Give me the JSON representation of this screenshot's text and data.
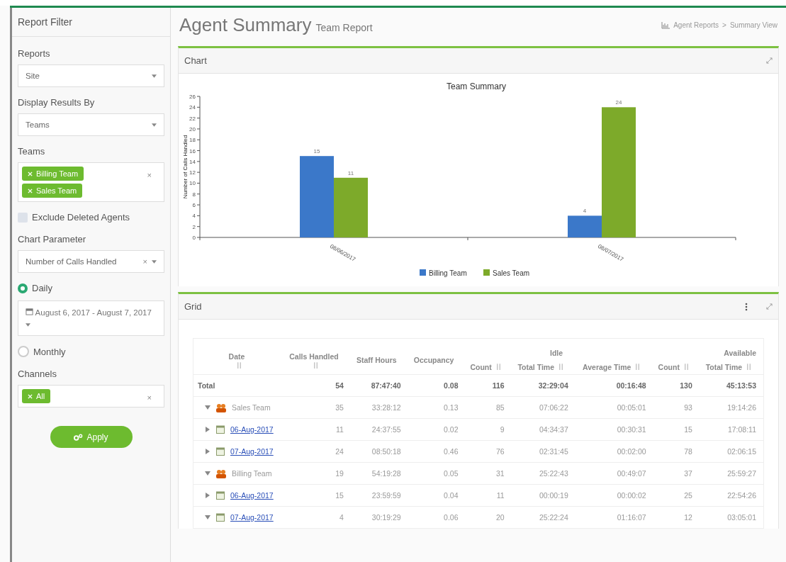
{
  "sidebar": {
    "title": "Report Filter",
    "reports": {
      "label": "Reports",
      "value": "Site"
    },
    "display_by": {
      "label": "Display Results By",
      "value": "Teams"
    },
    "teams": {
      "label": "Teams",
      "tags": [
        "Billing Team",
        "Sales Team"
      ],
      "clear": "×"
    },
    "exclude_deleted": {
      "label": "Exclude Deleted Agents",
      "checked": false
    },
    "chart_parameter": {
      "label": "Chart Parameter",
      "value": "Number of Calls Handled",
      "clear": "×"
    },
    "periods": [
      {
        "label": "Daily",
        "selected": true,
        "date_range": "August 6, 2017 - August 7, 2017"
      },
      {
        "label": "Monthly",
        "selected": false
      }
    ],
    "channels": {
      "label": "Channels",
      "tags": [
        "All"
      ],
      "clear": "×"
    },
    "apply": "Apply"
  },
  "header": {
    "title": "Agent Summary",
    "subtitle": "Team Report",
    "breadcrumb": [
      "Agent Reports",
      "Summary View"
    ],
    "separator": ">"
  },
  "chart_panel": {
    "title": "Chart",
    "chart_data": {
      "type": "bar",
      "title": "Team Summary",
      "ylabel": "Number of Calls Handled",
      "categories": [
        "08/06/2017",
        "08/07/2017"
      ],
      "series": [
        {
          "name": "Billing Team",
          "color": "#3b78c9",
          "values": [
            15,
            4
          ]
        },
        {
          "name": "Sales Team",
          "color": "#7daa2a",
          "values": [
            11,
            24
          ]
        }
      ],
      "ylim": [
        0,
        26
      ],
      "yticks": [
        0,
        2,
        4,
        6,
        8,
        10,
        12,
        14,
        16,
        18,
        20,
        22,
        24,
        26
      ],
      "data_labels": true,
      "legend": true
    }
  },
  "grid_panel": {
    "title": "Grid",
    "groups": [
      {
        "label": "Idle"
      },
      {
        "label": "Available"
      }
    ],
    "columns": [
      "Date",
      "Calls Handled",
      "Staff Hours",
      "Occupancy",
      "Count",
      "Total Time",
      "Average Time",
      "Count",
      "Total Time"
    ],
    "rows": [
      {
        "kind": "total",
        "cells": [
          "Total",
          "54",
          "87:47:40",
          "0.08",
          "116",
          "32:29:04",
          "00:16:48",
          "130",
          "45:13:53"
        ]
      },
      {
        "kind": "team",
        "expanded": true,
        "cells": [
          "Sales Team",
          "35",
          "33:28:12",
          "0.13",
          "85",
          "07:06:22",
          "00:05:01",
          "93",
          "19:14:26"
        ]
      },
      {
        "kind": "date",
        "expanded": false,
        "cells": [
          "06-Aug-2017",
          "11",
          "24:37:55",
          "0.02",
          "9",
          "04:34:37",
          "00:30:31",
          "15",
          "17:08:11"
        ]
      },
      {
        "kind": "date",
        "expanded": false,
        "cells": [
          "07-Aug-2017",
          "24",
          "08:50:18",
          "0.46",
          "76",
          "02:31:45",
          "00:02:00",
          "78",
          "02:06:15"
        ]
      },
      {
        "kind": "team",
        "expanded": true,
        "cells": [
          "Billing Team",
          "19",
          "54:19:28",
          "0.05",
          "31",
          "25:22:43",
          "00:49:07",
          "37",
          "25:59:27"
        ]
      },
      {
        "kind": "date",
        "expanded": false,
        "cells": [
          "06-Aug-2017",
          "15",
          "23:59:59",
          "0.04",
          "11",
          "00:00:19",
          "00:00:02",
          "25",
          "22:54:26"
        ]
      },
      {
        "kind": "date",
        "expanded": true,
        "cells": [
          "07-Aug-2017",
          "4",
          "30:19:29",
          "0.06",
          "20",
          "25:22:24",
          "01:16:07",
          "12",
          "03:05:01"
        ]
      }
    ]
  }
}
